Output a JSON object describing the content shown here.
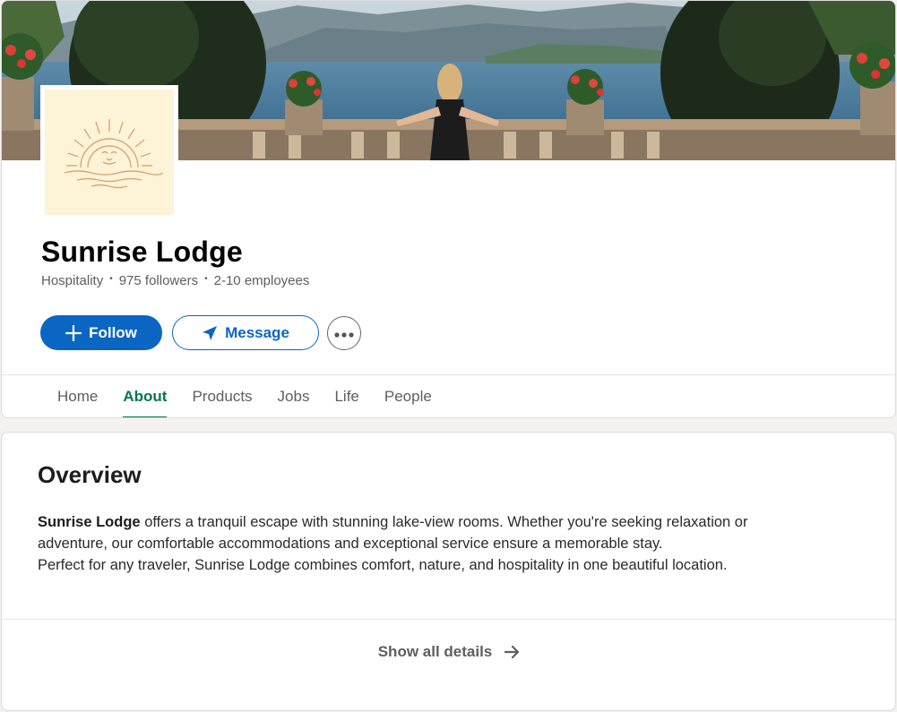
{
  "company": {
    "name": "Sunrise Lodge",
    "industry": "Hospitality",
    "followers": "975 followers",
    "employees": "2-10 employees"
  },
  "actions": {
    "follow_label": "Follow",
    "message_label": "Message",
    "more_icon": "ellipsis-icon"
  },
  "tabs": [
    {
      "label": "Home",
      "active": false
    },
    {
      "label": "About",
      "active": true
    },
    {
      "label": "Products",
      "active": false
    },
    {
      "label": "Jobs",
      "active": false
    },
    {
      "label": "Life",
      "active": false
    },
    {
      "label": "People",
      "active": false
    }
  ],
  "overview": {
    "title": "Overview",
    "lead_bold": "Sunrise Lodge",
    "line1_rest": " offers a tranquil escape with stunning lake-view rooms. Whether you're seeking relaxation or",
    "line2": "adventure, our comfortable accommodations and exceptional service ensure a memorable stay.",
    "line3": "Perfect for any traveler, Sunrise Lodge combines comfort, nature, and hospitality in one beautiful location.",
    "show_all_label": "Show all details"
  },
  "colors": {
    "primary": "#0a66c2",
    "active_tab": "#01754f",
    "logo_bg": "#fdf3d6",
    "logo_line": "#d9a679"
  }
}
